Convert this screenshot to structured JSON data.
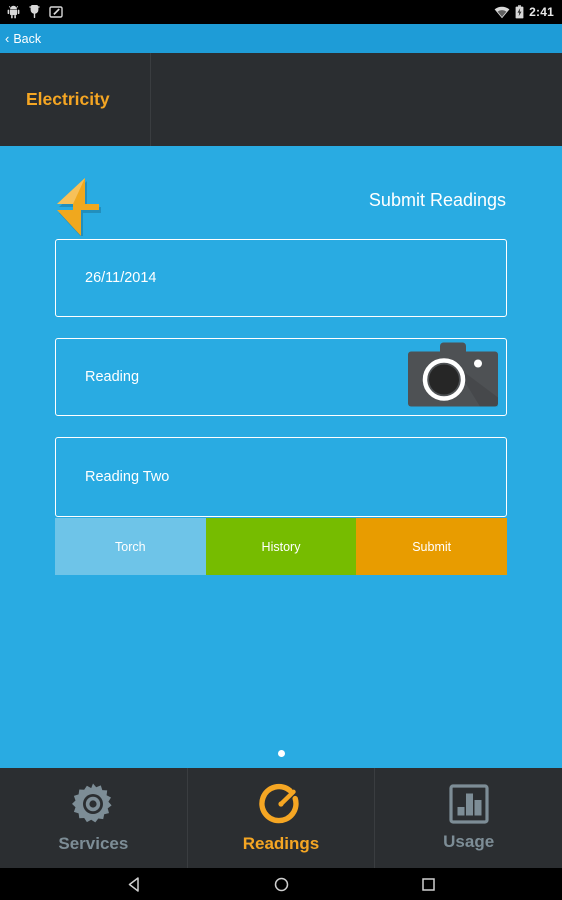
{
  "status_bar": {
    "icons": [
      "android-robot-icon",
      "usb-debug-icon",
      "screenshot-icon"
    ],
    "wifi_icon": "wifi-icon",
    "battery_icon": "battery-charging-icon",
    "time": "2:41"
  },
  "app_bar": {
    "back_chevron": "‹",
    "back_label": "Back"
  },
  "tabs": [
    {
      "label": "Electricity",
      "active": true
    }
  ],
  "main": {
    "bolt_icon": "lightning-bolt-icon",
    "title": "Submit Readings",
    "fields": [
      {
        "name": "date-field",
        "value": "26/11/2014",
        "has_camera": false
      },
      {
        "name": "reading-field",
        "value": "Reading",
        "has_camera": true,
        "camera_icon": "camera-icon"
      },
      {
        "name": "reading-two-field",
        "value": "Reading Two",
        "has_camera": false
      }
    ],
    "buttons": [
      {
        "label": "Torch",
        "color": "#6ec4e8"
      },
      {
        "label": "History",
        "color": "#76bc00"
      },
      {
        "label": "Submit",
        "color": "#e89c00"
      }
    ],
    "page_dots": {
      "count": 1,
      "active_index": 0
    }
  },
  "bottom_nav": [
    {
      "label": "Services",
      "icon": "gear-icon",
      "active": false
    },
    {
      "label": "Readings",
      "icon": "gauge-icon",
      "active": true
    },
    {
      "label": "Usage",
      "icon": "bar-chart-icon",
      "active": false
    }
  ],
  "system_nav": {
    "back": "back-triangle-icon",
    "home": "home-circle-icon",
    "recents": "recents-square-icon"
  },
  "colors": {
    "accent_blue": "#29abe2",
    "appbar_blue": "#1e9cd7",
    "amber": "#f5a623",
    "dark_panel": "#2b2e31",
    "nav_gray": "#7d8d96"
  }
}
